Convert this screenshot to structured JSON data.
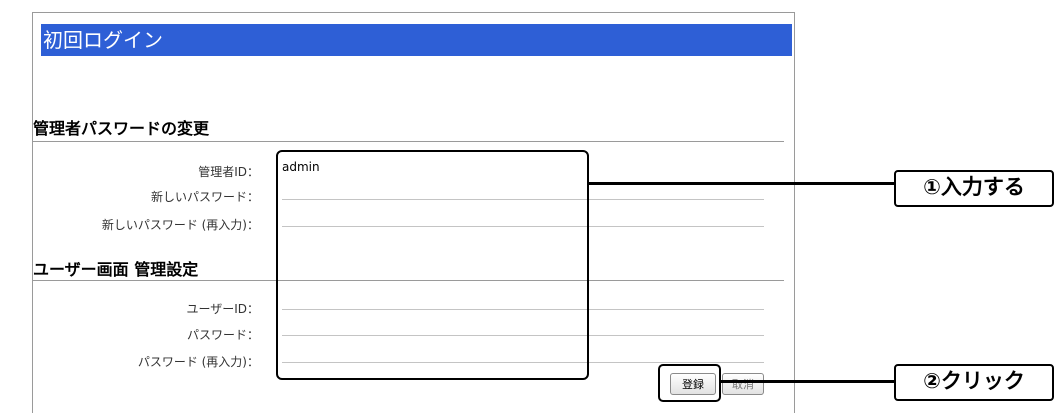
{
  "window": {
    "title": "初回ログイン"
  },
  "admin_section": {
    "title": "管理者パスワードの変更",
    "fields": [
      {
        "label": "管理者ID：",
        "value": "admin"
      },
      {
        "label": "新しいパスワード：",
        "value": ""
      },
      {
        "label": "新しいパスワード (再入力)：",
        "value": ""
      }
    ]
  },
  "user_section": {
    "title": "ユーザー画面 管理設定",
    "fields": [
      {
        "label": "ユーザーID：",
        "value": ""
      },
      {
        "label": "パスワード：",
        "value": ""
      },
      {
        "label": "パスワード (再入力)：",
        "value": ""
      }
    ]
  },
  "buttons": {
    "register": "登録",
    "cancel": "取消"
  },
  "annotations": {
    "step1": "①入力する",
    "step2": "②クリック"
  }
}
